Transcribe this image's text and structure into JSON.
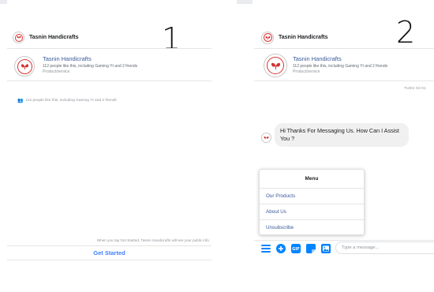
{
  "labels": {
    "panel1_number": "1",
    "panel2_number": "2"
  },
  "page": {
    "name": "Tasnin Handicrafts",
    "likes": "112 people like this, including Gaming Yt and 2 friends",
    "category": "Product/service"
  },
  "panel1": {
    "likes_summary": "112 people like this, including Gaming Yt and 2 friends",
    "disclaimer": "When you tap Get Started, Tasnin Handicrafts will see your public info.",
    "get_started_label": "Get Started"
  },
  "panel2": {
    "timestamp": "TUES 02:01",
    "message_text": "Hi Thanks For Messaging Us.  How Can I Assist You ?",
    "menu": {
      "title": "Menu",
      "items": [
        "Our Products",
        "About Us",
        "Unsubscribe"
      ]
    },
    "composer": {
      "placeholder": "Type a message...",
      "icons": [
        "menu-icon",
        "add-icon",
        "gif-icon",
        "sticker-icon",
        "image-icon"
      ]
    }
  },
  "colors": {
    "accent_blue": "#0084ff",
    "link_blue": "#385898",
    "bubble_gray": "#f1f0f0",
    "logo_red": "#d33333"
  }
}
